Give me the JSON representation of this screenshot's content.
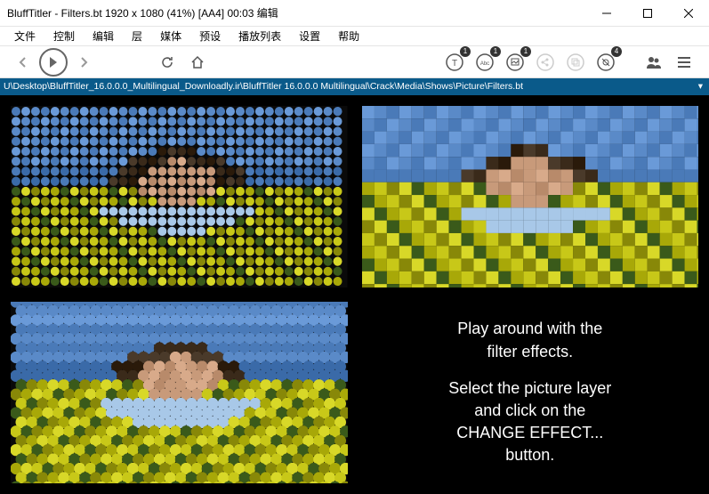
{
  "window": {
    "title": "BluffTitler - Filters.bt 1920 x 1080 (41%) [AA4] 00:03 编辑"
  },
  "menu": {
    "file": "文件",
    "control": "控制",
    "edit": "编辑",
    "layer": "层",
    "media": "媒体",
    "preset": "预设",
    "playlist": "播放列表",
    "settings": "设置",
    "help": "帮助"
  },
  "toolbar": {
    "badges": {
      "t": "1",
      "abc": "1",
      "pic": "1",
      "filter": "4"
    }
  },
  "path": {
    "text": "U\\Desktop\\BluffTitler_16.0.0.0_Multilingual_Downloadly.ir\\BluffTitler 16.0.0.0 Multilingual\\Crack\\Media\\Shows\\Picture\\Filters.bt"
  },
  "overlay": {
    "line1": "Play around with the",
    "line2": "filter effects.",
    "line3": "Select the picture layer",
    "line4": "and click on the",
    "line5": "CHANGE EFFECT...",
    "line6": "button."
  }
}
